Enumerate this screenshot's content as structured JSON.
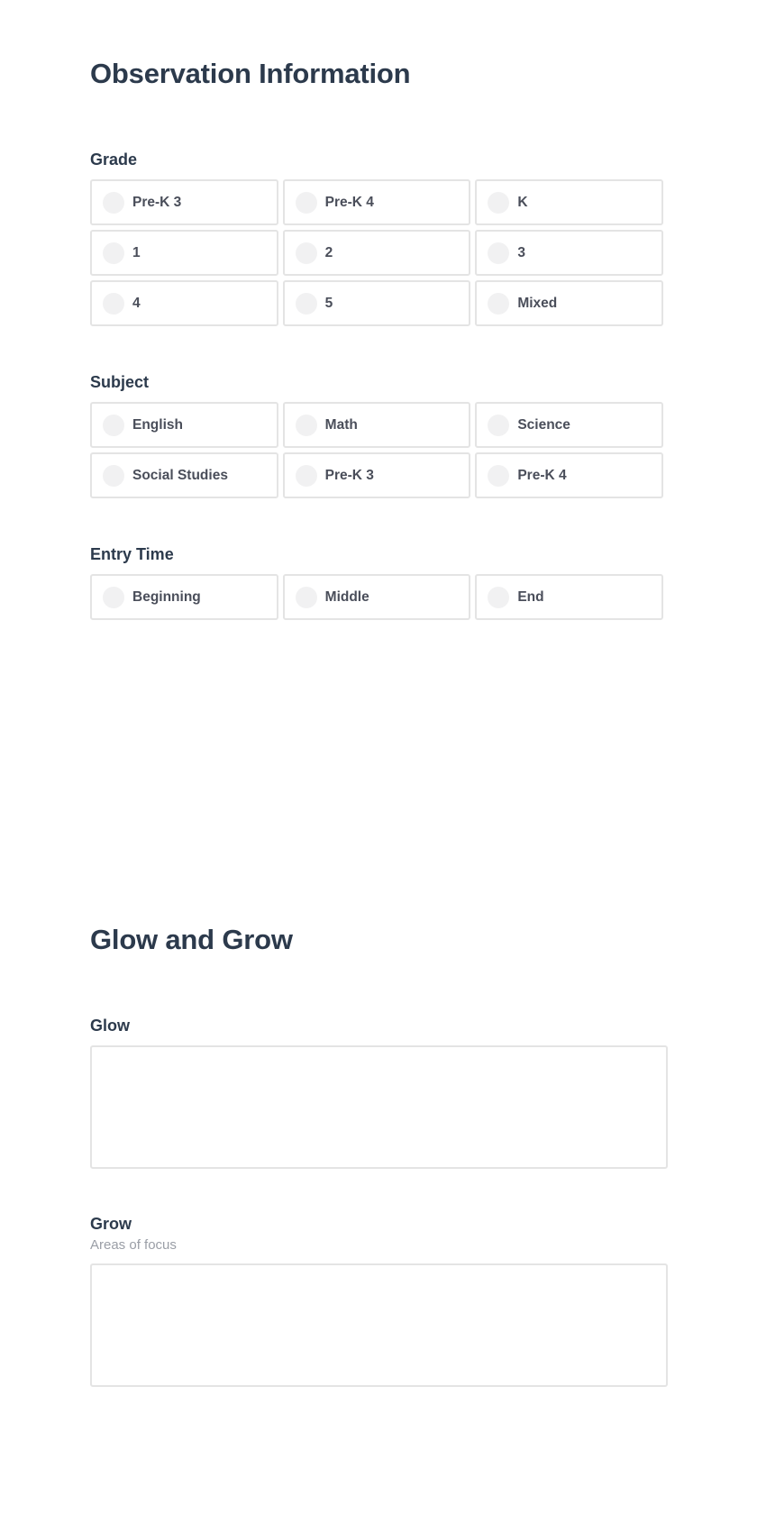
{
  "observation": {
    "title": "Observation Information",
    "grade": {
      "label": "Grade",
      "options": [
        "Pre-K 3",
        "Pre-K 4",
        "K",
        "1",
        "2",
        "3",
        "4",
        "5",
        "Mixed"
      ]
    },
    "subject": {
      "label": "Subject",
      "options": [
        "English",
        "Math",
        "Science",
        "Social Studies",
        "Pre-K 3",
        "Pre-K 4"
      ]
    },
    "entry_time": {
      "label": "Entry Time",
      "options": [
        "Beginning",
        "Middle",
        "End"
      ]
    }
  },
  "glow_and_grow": {
    "title": "Glow and Grow",
    "glow": {
      "label": "Glow",
      "value": ""
    },
    "grow": {
      "label": "Grow",
      "hint": "Areas of focus",
      "value": ""
    }
  },
  "colors": {
    "heading": "#2c3a4c",
    "option_text": "#4a4e5a",
    "hint_text": "#9a9ea6",
    "border": "#e4e4e4",
    "radio_fill": "#f1f1f2"
  }
}
